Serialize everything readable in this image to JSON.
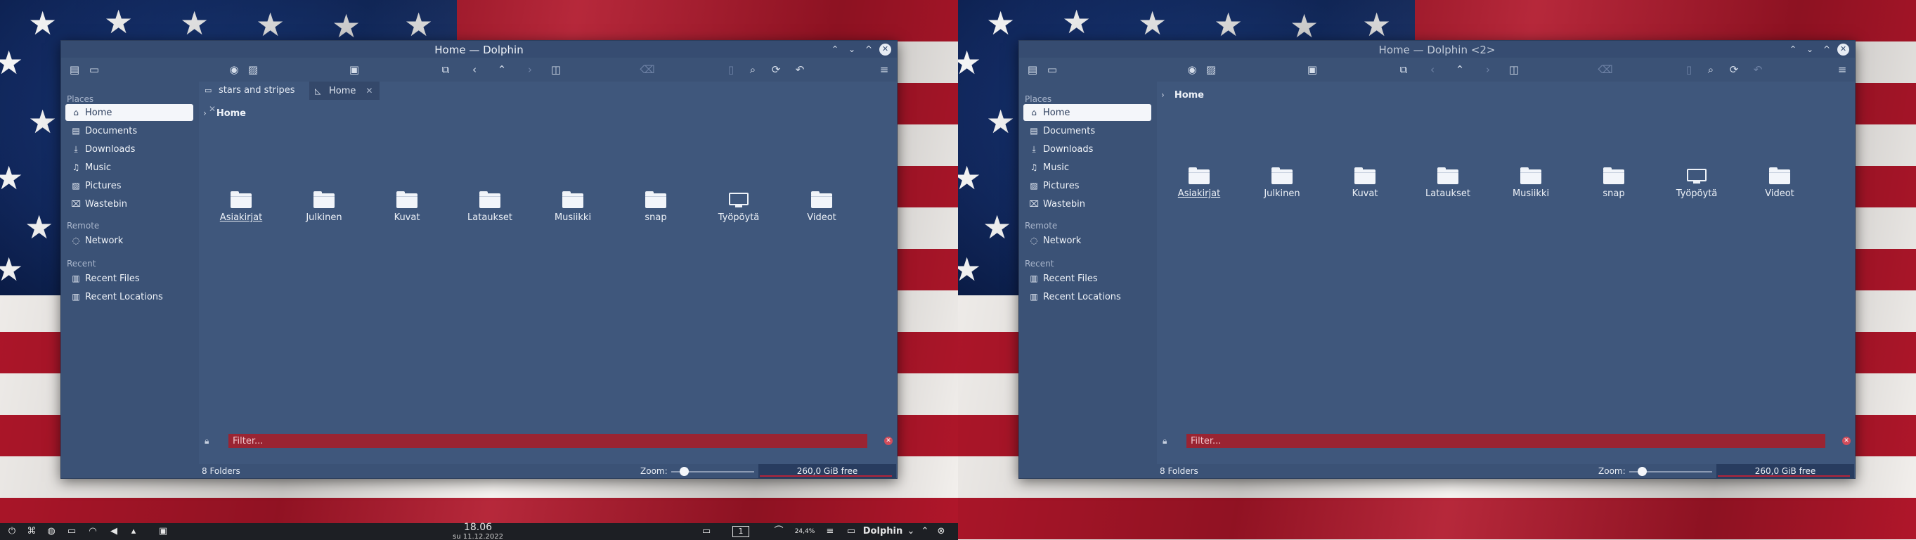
{
  "screens": [
    {
      "window": {
        "title": "Home — Dolphin",
        "active": true,
        "titlebar_buttons": [
          "keep-above",
          "minimize",
          "maximize",
          "close"
        ],
        "tabs": [
          {
            "label": "stars and stripes",
            "icon": "folder-icon",
            "active": false
          },
          {
            "label": "Home",
            "icon": "home-folder-icon",
            "active": true
          }
        ]
      },
      "taskbar": true
    },
    {
      "window": {
        "title": "Home — Dolphin <2>",
        "active": false,
        "titlebar_buttons": [
          "keep-above",
          "minimize",
          "maximize",
          "close"
        ],
        "tabs": []
      },
      "taskbar": false
    }
  ],
  "sidebar": {
    "places_title": "Places",
    "places": [
      {
        "label": "Home",
        "icon": "home-icon",
        "selected": true
      },
      {
        "label": "Documents",
        "icon": "documents-icon"
      },
      {
        "label": "Downloads",
        "icon": "downloads-icon"
      },
      {
        "label": "Music",
        "icon": "music-icon"
      },
      {
        "label": "Pictures",
        "icon": "pictures-icon"
      },
      {
        "label": "Wastebin",
        "icon": "trash-icon"
      }
    ],
    "remote_title": "Remote",
    "remote": [
      {
        "label": "Network",
        "icon": "network-icon"
      }
    ],
    "recent_title": "Recent",
    "recent": [
      {
        "label": "Recent Files",
        "icon": "recent-files-icon"
      },
      {
        "label": "Recent Locations",
        "icon": "recent-locations-icon"
      }
    ]
  },
  "breadcrumb": {
    "current": "Home"
  },
  "folders": [
    {
      "name": "Asiakirjat",
      "icon": "folder-icon",
      "hovered": true
    },
    {
      "name": "Julkinen",
      "icon": "folder-icon"
    },
    {
      "name": "Kuvat",
      "icon": "folder-icon"
    },
    {
      "name": "Lataukset",
      "icon": "folder-icon"
    },
    {
      "name": "Musiikki",
      "icon": "folder-icon"
    },
    {
      "name": "snap",
      "icon": "folder-icon"
    },
    {
      "name": "Työpöytä",
      "icon": "desktop-icon"
    },
    {
      "name": "Videot",
      "icon": "folder-icon"
    }
  ],
  "filter": {
    "placeholder": "Filter..."
  },
  "status": {
    "count": "8 Folders",
    "zoom_label": "Zoom:",
    "zoom_level_fraction": 0.15,
    "free_space": "260,0 GiB free",
    "used_fraction": 0.98
  },
  "toolbar_icons": [
    "sidebar-icon",
    "panel-icon",
    "preview-icon",
    "image-icon",
    "terminal-icon",
    "new-tab-icon",
    "back-icon",
    "up-icon",
    "forward-icon",
    "split-view-icon",
    "trash-icon",
    "copy-icon",
    "search-icon",
    "reload-icon",
    "undo-icon",
    "menu-icon"
  ],
  "taskbar": {
    "clock_time": "18.06",
    "clock_date": "su 11.12.2022",
    "desktop_number": "1",
    "cpu_label": "24,4%",
    "task_title": "Dolphin"
  },
  "colors": {
    "window_bg": "#3d5478",
    "selection": "#f4f6fa",
    "filter_bg": "#9a2432",
    "flag_red": "#b0162a",
    "flag_blue": "#11285e"
  }
}
